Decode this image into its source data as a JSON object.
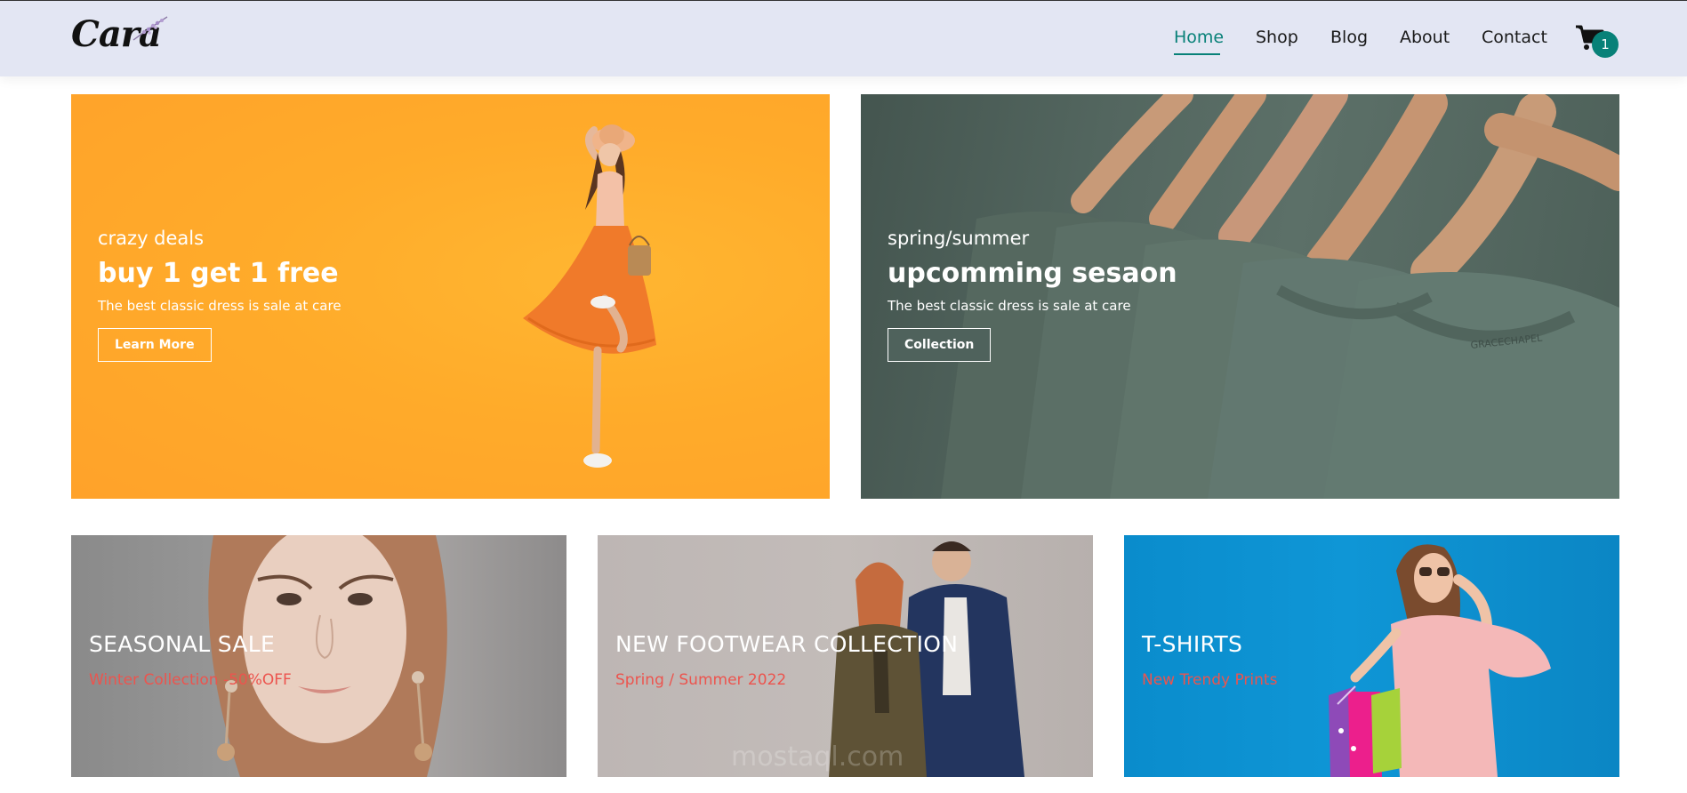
{
  "brand": {
    "logo_text": "Cara"
  },
  "nav": {
    "items": [
      {
        "label": "Home",
        "active": true
      },
      {
        "label": "Shop",
        "active": false
      },
      {
        "label": "Blog",
        "active": false
      },
      {
        "label": "About",
        "active": false
      },
      {
        "label": "Contact",
        "active": false
      }
    ],
    "cart_count": "1"
  },
  "hero": {
    "left": {
      "kicker": "crazy deals",
      "title": "buy 1 get 1 free",
      "subtitle": "The best classic dress is sale at care",
      "button": "Learn More"
    },
    "right": {
      "kicker": "spring/summer",
      "title": "upcomming sesaon",
      "subtitle": "The best classic dress is sale at care",
      "button": "Collection",
      "tag_text": "GRACECHAPEL"
    }
  },
  "promos": [
    {
      "title": "SEASONAL SALE",
      "subtitle": "Winter Collection -50%OFF"
    },
    {
      "title": "NEW FOOTWEAR COLLECTION",
      "subtitle": "Spring / Summer 2022"
    },
    {
      "title": "T-SHIRTS",
      "subtitle": "New Trendy Prints"
    }
  ],
  "watermark": "mostaql.com",
  "colors": {
    "header_bg": "#e3e6f3",
    "accent": "#088178",
    "promo_subtitle": "#ec544e",
    "banner_yellow": "#ffab2a",
    "banner_green": "#53665f",
    "banner_blue": "#0f96d6"
  }
}
